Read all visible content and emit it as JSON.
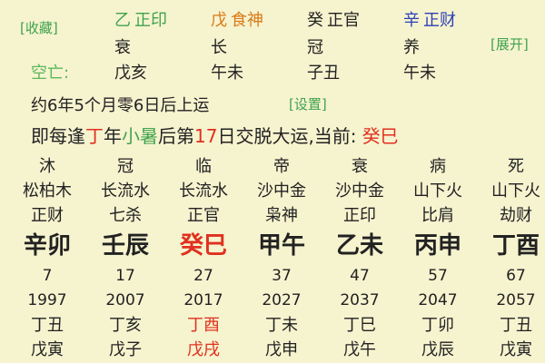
{
  "top": {
    "collect_label": "[收藏]",
    "expand_label": "[展开]",
    "pillars": [
      {
        "stem": "乙",
        "god": "正印",
        "color": "#3fa34d",
        "state": "衰"
      },
      {
        "stem": "戊",
        "god": "食神",
        "color": "#d97a16",
        "state": "长"
      },
      {
        "stem": "癸",
        "god": "正官",
        "color": "#222222",
        "state": "冠"
      },
      {
        "stem": "辛",
        "god": "正财",
        "color": "#2c3fb8",
        "state": "养"
      }
    ],
    "kongwang_label": "空亡:",
    "kongwang_values": [
      "戊亥",
      "午未",
      "子丑",
      "午未"
    ]
  },
  "yun": {
    "start_text": "约6年5个月零6日后上运",
    "settings_label": "[设置]",
    "line2_prefix": "即每逢",
    "line2_stem": "丁",
    "line2_year": "年",
    "line2_term": "小暑",
    "line2_mid": "后第",
    "line2_day": "17",
    "line2_suffix": "日交脱大运,当前:",
    "current": "癸巳"
  },
  "columns": [
    {
      "state": "沐",
      "nayin": "松柏木",
      "god": "正财",
      "ganzhi": "辛卯",
      "age": "7",
      "year": "1997",
      "row1": "丁丑",
      "row2": "戊寅",
      "highlight": false
    },
    {
      "state": "冠",
      "nayin": "长流水",
      "god": "七杀",
      "ganzhi": "壬辰",
      "age": "17",
      "year": "2007",
      "row1": "丁亥",
      "row2": "戊子",
      "highlight": false
    },
    {
      "state": "临",
      "nayin": "长流水",
      "god": "正官",
      "ganzhi": "癸巳",
      "age": "27",
      "year": "2017",
      "row1": "丁酉",
      "row2": "戊戌",
      "highlight": true
    },
    {
      "state": "帝",
      "nayin": "沙中金",
      "god": "枭神",
      "ganzhi": "甲午",
      "age": "37",
      "year": "2027",
      "row1": "丁未",
      "row2": "戊申",
      "highlight": false
    },
    {
      "state": "衰",
      "nayin": "沙中金",
      "god": "正印",
      "ganzhi": "乙未",
      "age": "47",
      "year": "2037",
      "row1": "丁巳",
      "row2": "戊午",
      "highlight": false
    },
    {
      "state": "病",
      "nayin": "山下火",
      "god": "比肩",
      "ganzhi": "丙申",
      "age": "57",
      "year": "2047",
      "row1": "丁卯",
      "row2": "戊辰",
      "highlight": false
    },
    {
      "state": "死",
      "nayin": "山下火",
      "god": "劫财",
      "ganzhi": "丁酉",
      "age": "67",
      "year": "2057",
      "row1": "丁丑",
      "row2": "戊寅",
      "highlight": false
    }
  ]
}
